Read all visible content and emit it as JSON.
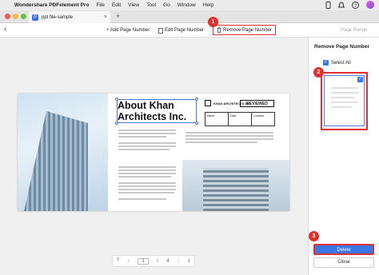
{
  "menubar": {
    "apple": "",
    "app_name": "Wondershare PDFelement Pro",
    "items": [
      "File",
      "Edit",
      "View",
      "Tool",
      "Go",
      "Window",
      "Help"
    ]
  },
  "tab": {
    "title": "ppt file-sample",
    "close": "×",
    "new_tab": "+"
  },
  "toolbar": {
    "add": "+ Add Page Number",
    "edit": "Edit Page Number",
    "remove": "Remove Page Number",
    "range": "Page Range"
  },
  "badges": {
    "one": "1",
    "two": "2",
    "three": "3"
  },
  "document": {
    "title": "About Khan Architects Inc.",
    "logo_text": "KHAN ARCHITECTS INC.",
    "reviewed": "REVIEWED",
    "info": [
      "Name",
      "Date",
      "Location"
    ]
  },
  "pager": {
    "current": "1",
    "total": "4",
    "separator": "/"
  },
  "panel": {
    "title": "Remove Page Number",
    "select_all": "Select All",
    "delete": "Delete",
    "close": "Close"
  },
  "colors": {
    "accent": "#3a78e8",
    "highlight": "#e0312f"
  }
}
